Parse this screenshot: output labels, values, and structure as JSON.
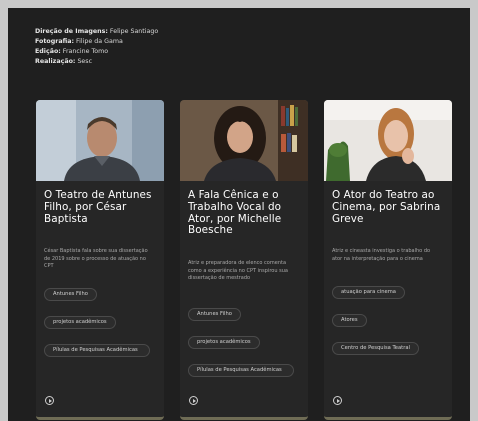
{
  "credits": [
    {
      "label": "Direção de Imagens:",
      "value": " Felipe Santiago"
    },
    {
      "label": "Fotografia:",
      "value": " Filipe da Gama"
    },
    {
      "label": "Edição:",
      "value": " Francine Tomo"
    },
    {
      "label": "Realização:",
      "value": " Sesc"
    }
  ],
  "cards": [
    {
      "title": "O Teatro de Antunes Filho, por César Baptista",
      "description": "César Baptista fala sobre sua dissertação de 2019 sobre o processo de atuação no CPT",
      "tags": [
        "Antunes Filho",
        "projetos acadêmicos",
        "Pílulas de Pesquisas Acadêmicas"
      ],
      "play_icon": "play-circle-icon"
    },
    {
      "title": "A Fala Cênica e o Trabalho Vocal do Ator, por Michelle Boesche",
      "description": "Atriz e preparadora de elenco comenta como a experiência no CPT inspirou sua dissertação de mestrado",
      "tags": [
        "Antunes Filho",
        "projetos acadêmicos",
        "Pílulas de Pesquisas Acadêmicas"
      ],
      "play_icon": "play-circle-icon"
    },
    {
      "title": "O Ator do Teatro ao Cinema, por Sabrina Greve",
      "description": "Atriz e cineasta investiga o trabalho do ator na interpretação para o cinema",
      "tags": [
        "atuação para cinema",
        "Atores",
        "Centro de Pesquisa Teatral"
      ],
      "play_icon": "play-circle-icon"
    }
  ]
}
